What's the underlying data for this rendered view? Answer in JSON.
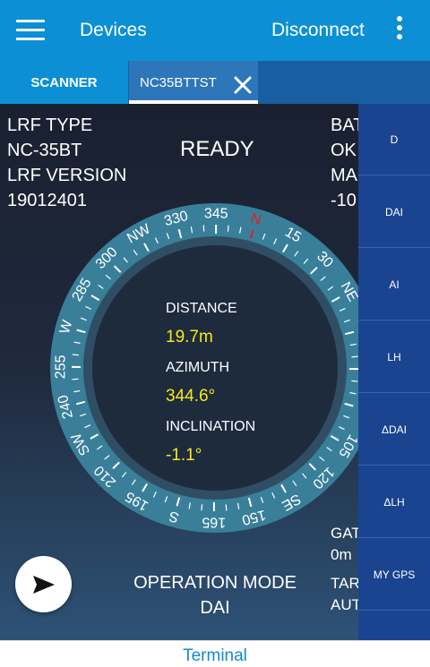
{
  "appbar": {
    "title": "Devices",
    "disconnect_label": "Disconnect"
  },
  "tabs": {
    "scanner": "SCANNER",
    "device": "NC35BTTST"
  },
  "left_info": {
    "lrf_type_label": "LRF TYPE",
    "lrf_type_value": "NC-35BT",
    "lrf_version_label": "LRF VERSION",
    "lrf_version_value": "19012401"
  },
  "status": "READY",
  "right_info": {
    "battery_label": "BAT",
    "battery_value": "OK",
    "ma_label": "MA",
    "ma_value": "-10",
    "gat_label": "GAT",
    "gat_value": "0m",
    "tar_label": "TAR",
    "tar_value": "AUT"
  },
  "compass": {
    "north": "N",
    "labels": [
      "345",
      "330",
      "NW",
      "300",
      "285",
      "W",
      "255",
      "240",
      "SW",
      "210",
      "195",
      "S",
      "165",
      "150",
      "SE",
      "120",
      "105",
      "NE",
      "30",
      "15"
    ],
    "ring_color": "#3a7f9a",
    "north_color": "#e02020"
  },
  "measurements": {
    "distance_label": "DISTANCE",
    "distance_value": "19.7m",
    "azimuth_label": "AZIMUTH",
    "azimuth_value": "344.6°",
    "inclination_label": "INCLINATION",
    "inclination_value": "-1.1°",
    "value_color": "#f7ea1a"
  },
  "operation_mode": {
    "label": "OPERATION MODE",
    "value": "DAI"
  },
  "side_buttons": [
    "D",
    "DAI",
    "AI",
    "LH",
    "ΔDAI",
    "ΔLH",
    "MY GPS"
  ],
  "bottom": {
    "terminal": "Terminal"
  },
  "icons": {
    "menu": "hamburger-icon",
    "more": "more-vert-icon",
    "close": "close-icon",
    "send": "send-icon"
  }
}
